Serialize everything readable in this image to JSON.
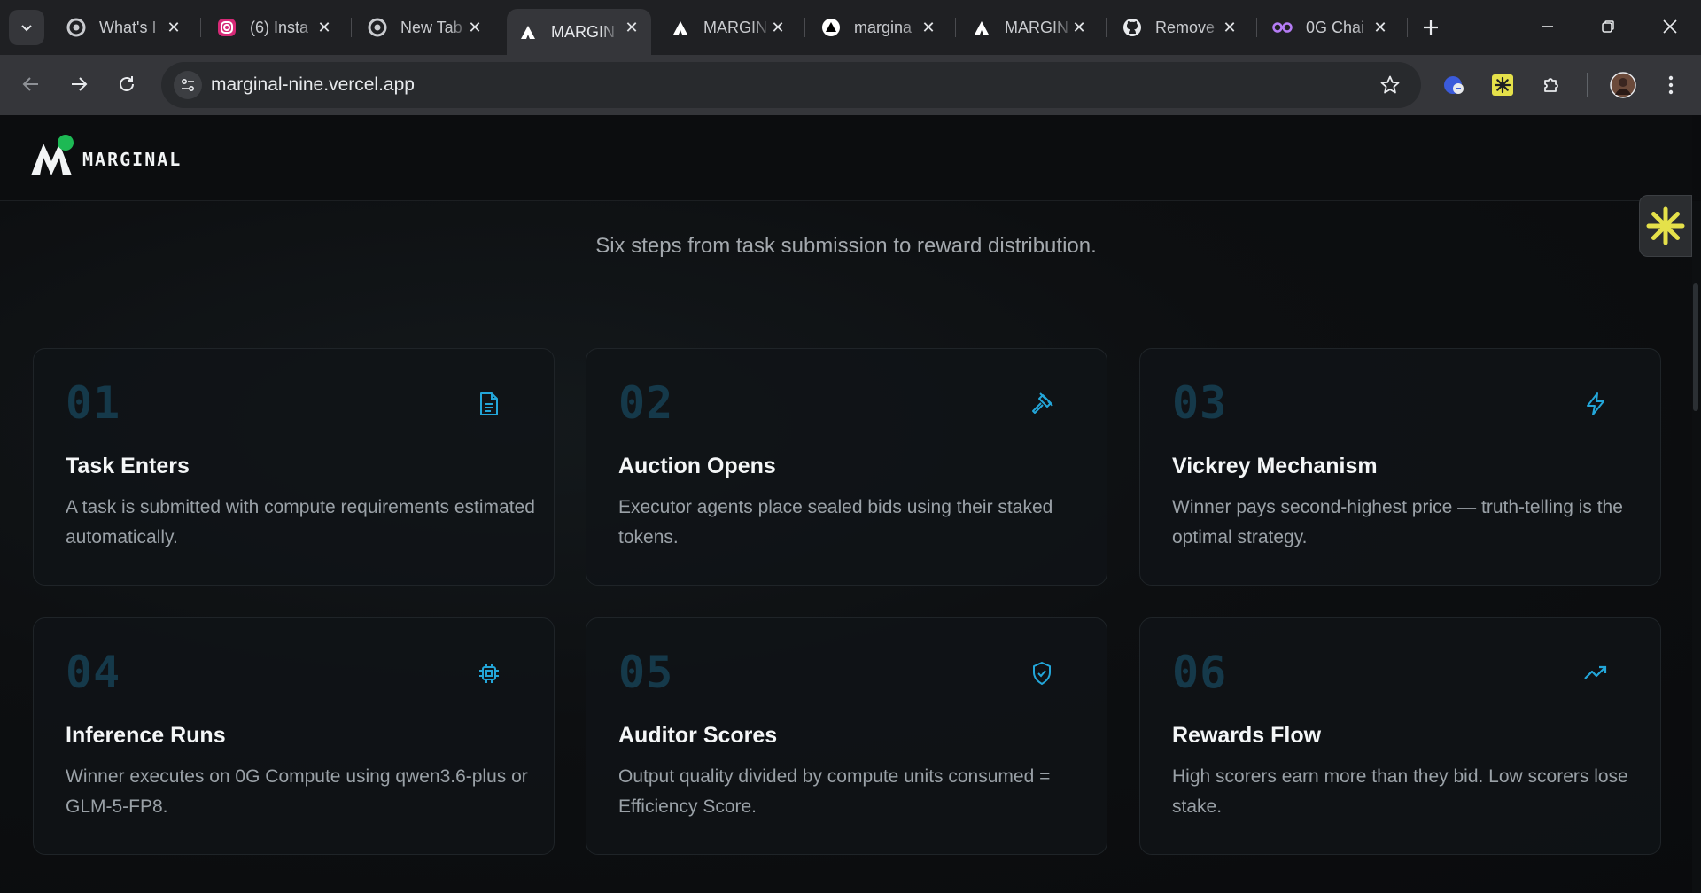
{
  "browser": {
    "tabs": [
      {
        "title": "What's I",
        "icon": "chrome-icon",
        "active": false
      },
      {
        "title": "(6) Insta",
        "icon": "instagram-icon",
        "active": false
      },
      {
        "title": "New Tab",
        "icon": "chrome-icon",
        "active": false
      },
      {
        "title": "MARGIN",
        "icon": "marginal-icon",
        "active": true
      },
      {
        "title": "MARGIN",
        "icon": "marginal-icon",
        "active": false
      },
      {
        "title": "margina",
        "icon": "vercel-icon",
        "active": false
      },
      {
        "title": "MARGIN",
        "icon": "marginal-icon",
        "active": false
      },
      {
        "title": "Remove",
        "icon": "github-icon",
        "active": false
      },
      {
        "title": "0G Chai",
        "icon": "og-icon",
        "active": false
      }
    ],
    "url": "marginal-nine.vercel.app"
  },
  "site": {
    "logo_text": "MARGINAL",
    "subtitle": "Six steps from task submission to reward distribution."
  },
  "steps": [
    {
      "num": "01",
      "title": "Task Enters",
      "desc": "A task is submitted with compute requirements estimated automatically.",
      "icon": "document-icon"
    },
    {
      "num": "02",
      "title": "Auction Opens",
      "desc": "Executor agents place sealed bids using their staked tokens.",
      "icon": "gavel-icon"
    },
    {
      "num": "03",
      "title": "Vickrey Mechanism",
      "desc": "Winner pays second-highest price — truth-telling is the optimal strategy.",
      "icon": "lightning-icon"
    },
    {
      "num": "04",
      "title": "Inference Runs",
      "desc": "Winner executes on 0G Compute using qwen3.6-plus or GLM-5-FP8.",
      "icon": "cpu-icon"
    },
    {
      "num": "05",
      "title": "Auditor Scores",
      "desc": "Output quality divided by compute units consumed = Efficiency Score.",
      "icon": "shield-check-icon"
    },
    {
      "num": "06",
      "title": "Rewards Flow",
      "desc": "High scorers earn more than they bid. Low scorers lose stake.",
      "icon": "trending-up-icon"
    }
  ],
  "colors": {
    "accent": "#23a6d9",
    "step_number": "#15394a",
    "logo_dot": "#1db954"
  }
}
